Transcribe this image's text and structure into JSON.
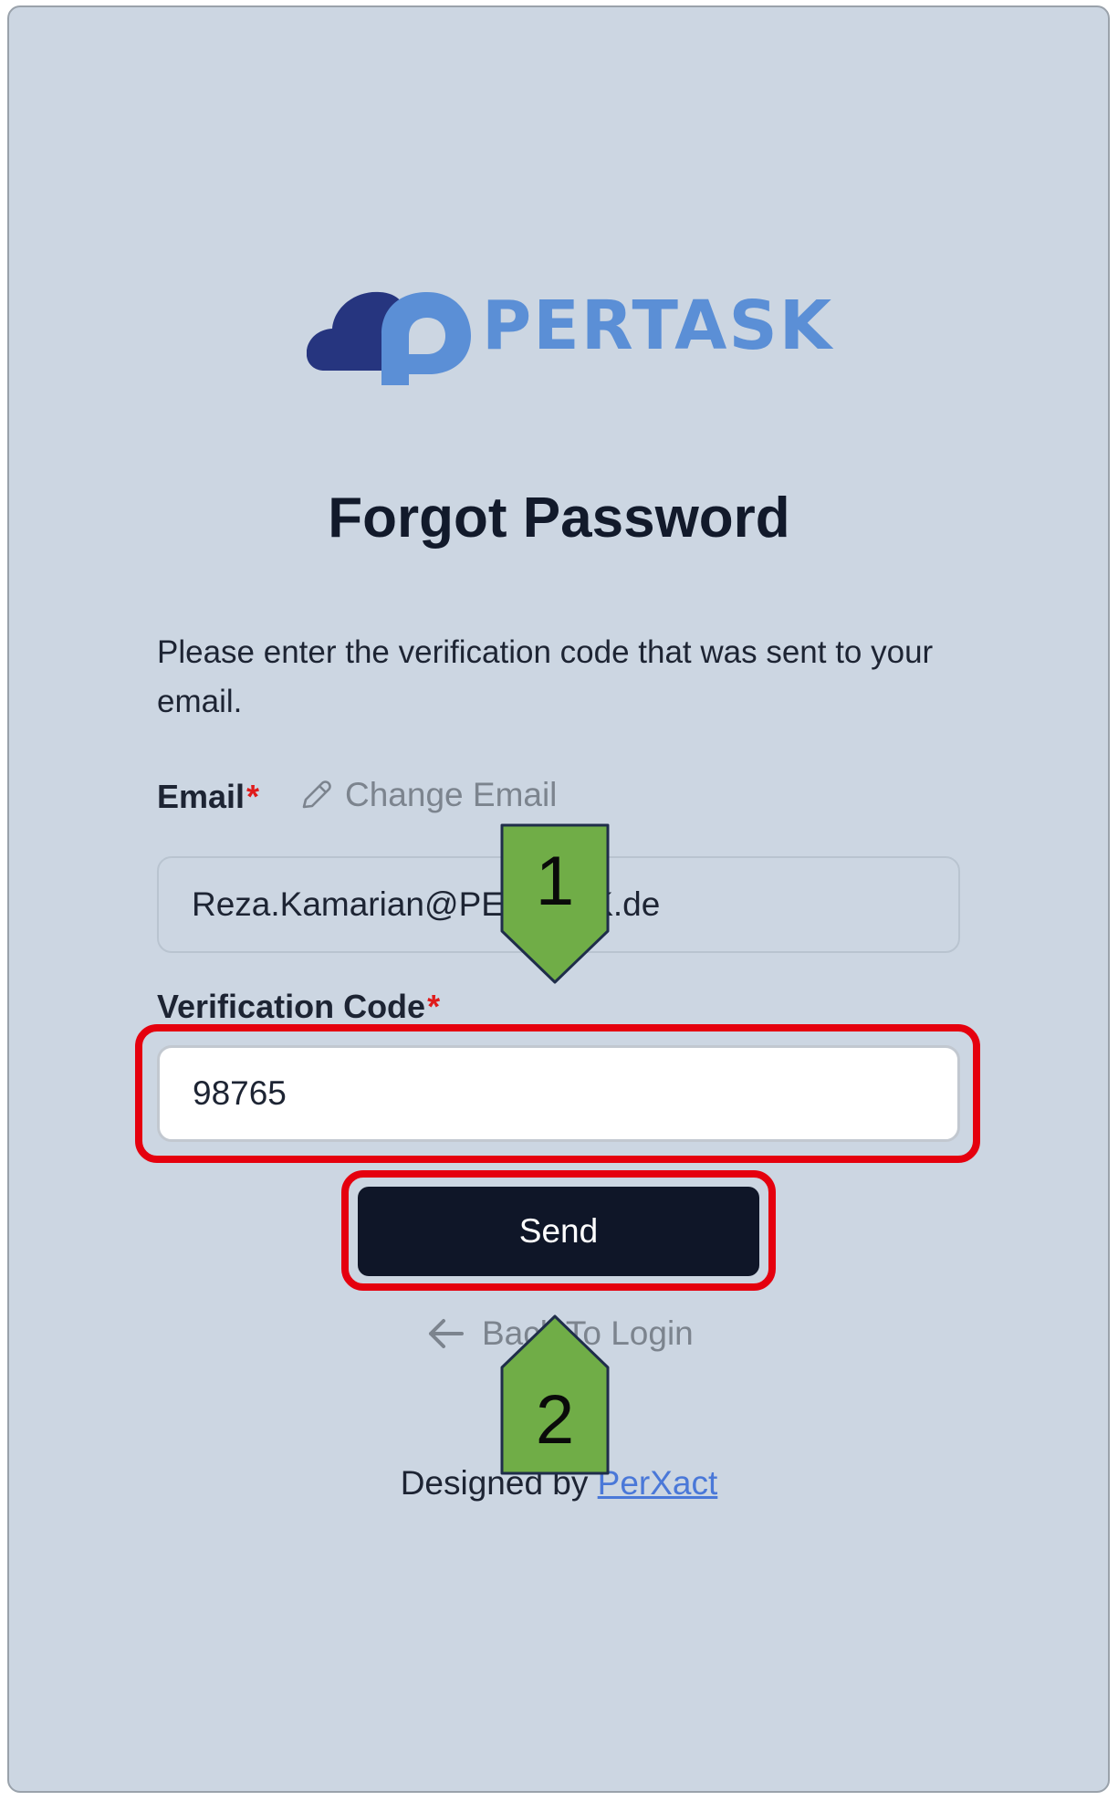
{
  "brand": {
    "logo_text": "PERTASK",
    "logo_color": "#5b8fd6",
    "logo_dark_color": "#26357f"
  },
  "page": {
    "title": "Forgot Password",
    "instructions": "Please enter the verification code that was sent to your email."
  },
  "form": {
    "email_label": "Email",
    "required_mark": "*",
    "change_email_label": "Change Email",
    "change_email_icon": "pencil-icon",
    "email_value": "Reza.Kamarian@PERTASK.de",
    "code_label": "Verification Code",
    "code_value": "98765",
    "send_label": "Send"
  },
  "nav": {
    "back_label": "Back To Login",
    "back_icon": "arrow-left-icon"
  },
  "footer": {
    "prefix": "Designed by",
    "link_label": "PerXact",
    "link_color": "#4a78d8"
  },
  "annotations": {
    "markers": [
      {
        "number": "1",
        "color": "#70ad47"
      },
      {
        "number": "2",
        "color": "#70ad47"
      }
    ],
    "highlight_color": "#e5000e"
  }
}
